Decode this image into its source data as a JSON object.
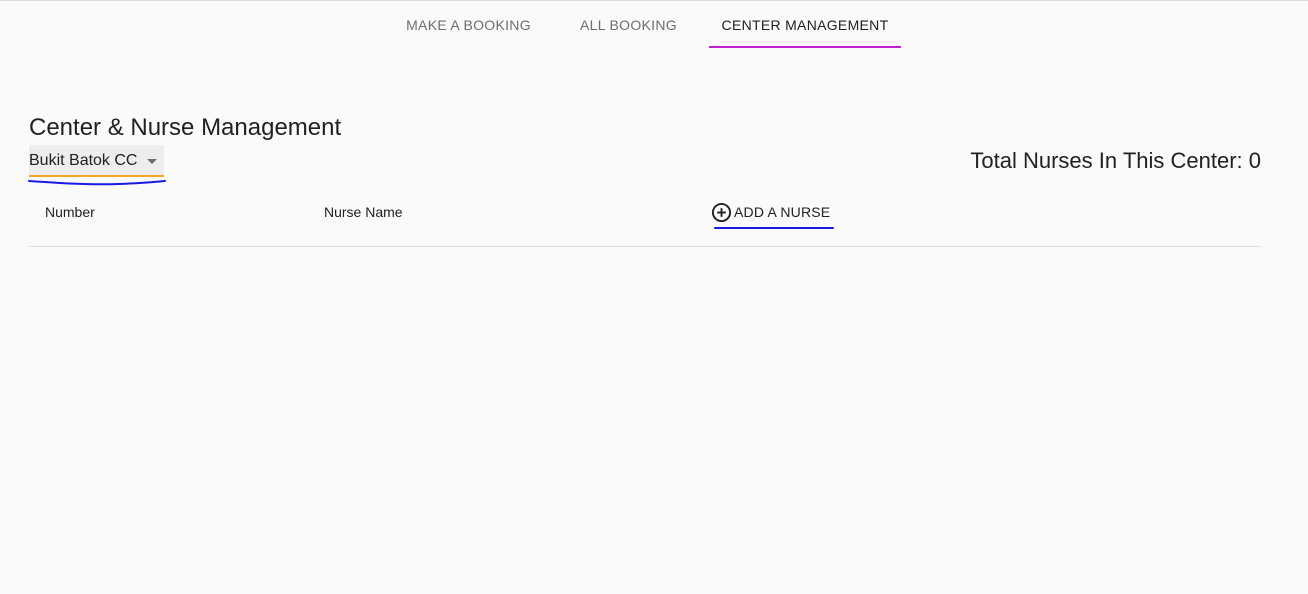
{
  "nav": {
    "tabs": [
      {
        "label": "MAKE A BOOKING"
      },
      {
        "label": "ALL BOOKING"
      },
      {
        "label": "CENTER MANAGEMENT"
      }
    ],
    "active_tab": "CENTER MANAGEMENT",
    "indicator_color": "#c31ed2"
  },
  "page": {
    "title": "Center & Nurse Management",
    "center_select": {
      "value": "Bukit Batok CC",
      "underline_color": "#f5a623",
      "icon": "dropdown-arrow-icon"
    },
    "total_nurses_label": "Total Nurses In This Center: 0"
  },
  "table": {
    "columns": [
      "Number",
      "Nurse Name"
    ],
    "add_button": {
      "label": "ADD A NURSE",
      "icon": "add-circle-icon"
    },
    "rows": []
  },
  "colors": {
    "background": "#fafafa",
    "annotation_blue": "#1a1ae6"
  }
}
